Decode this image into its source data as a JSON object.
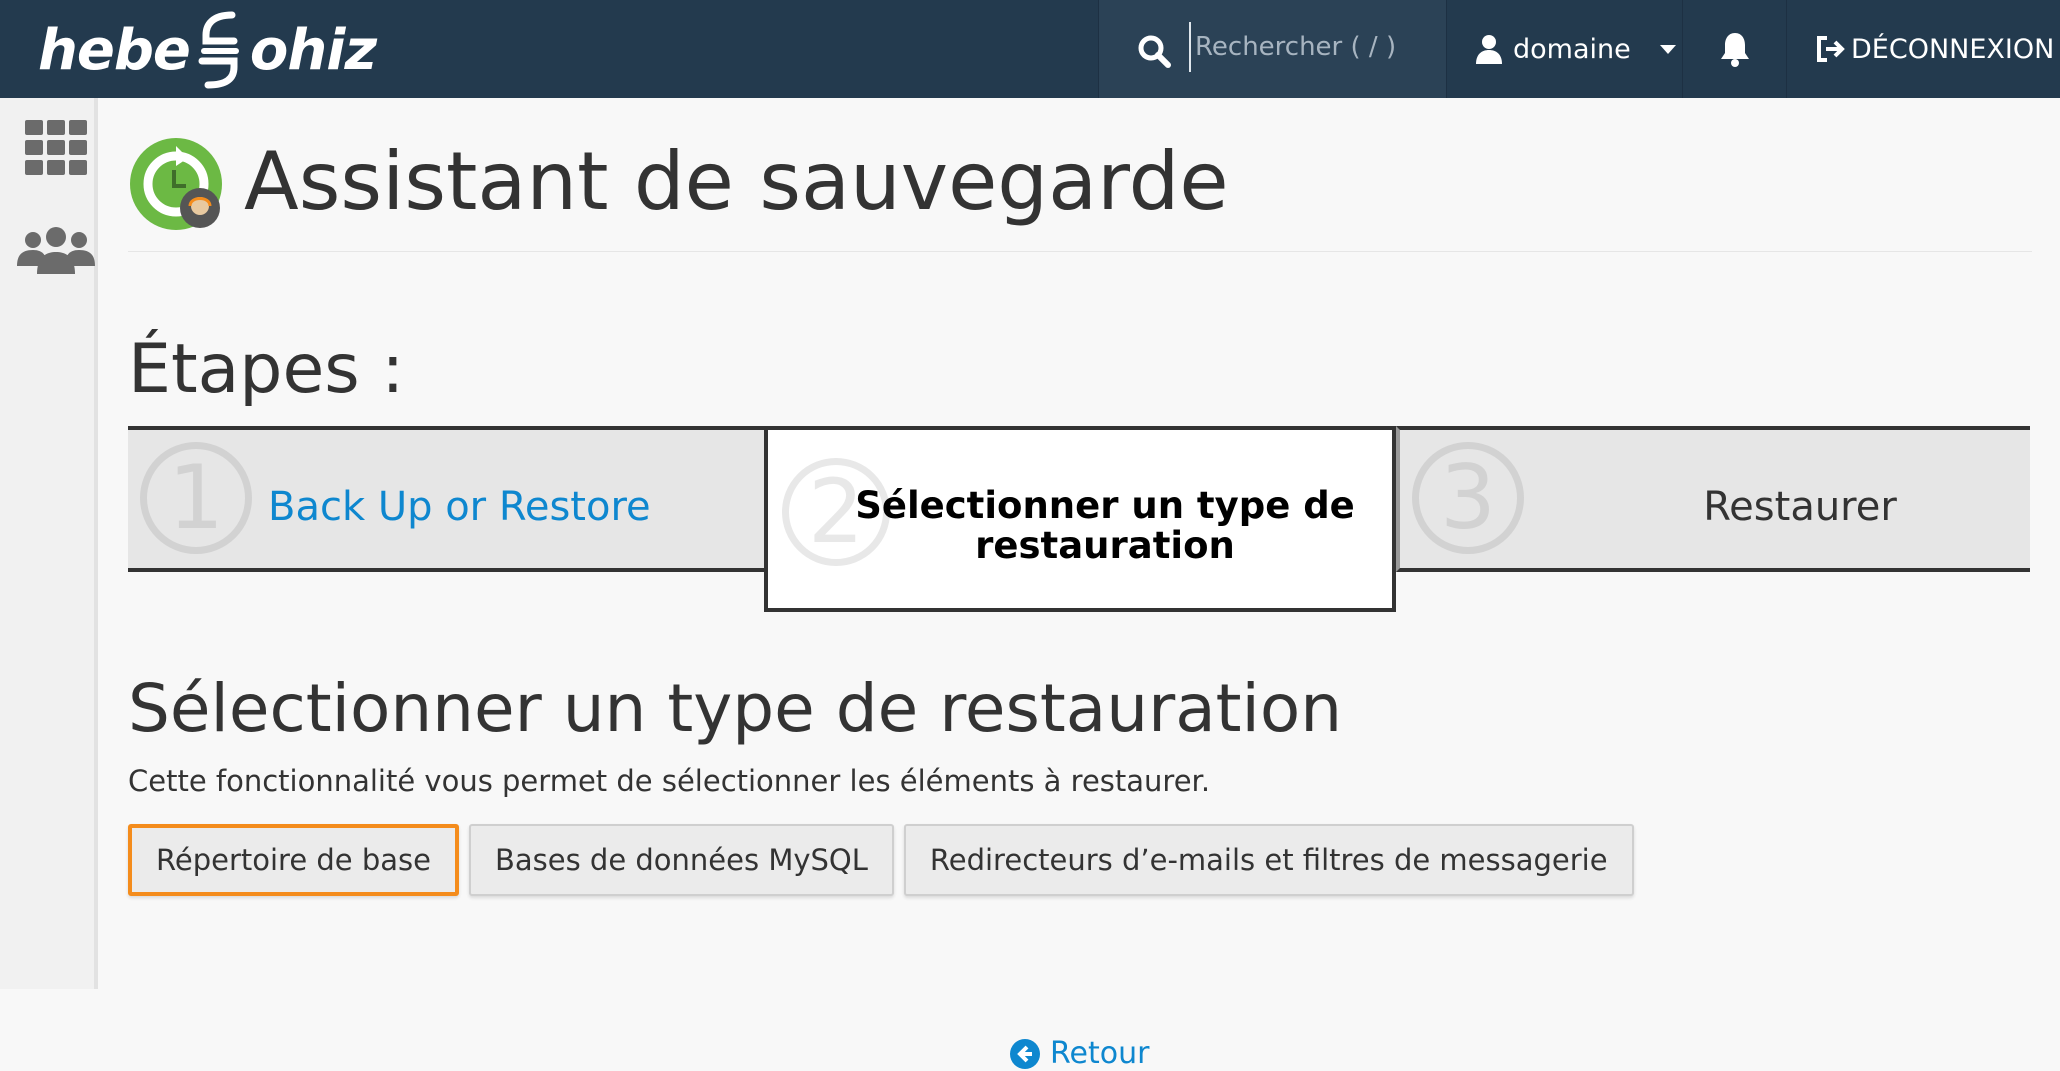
{
  "brand": {
    "logo_left": "hebe",
    "logo_right": "ohiz",
    "colors": {
      "topbar": "#233a4e",
      "link": "#0e87cf",
      "active_outline": "#f48c1c",
      "accent_green": "#6cb944"
    }
  },
  "topbar": {
    "search_placeholder": "Rechercher ( / )",
    "user_label": "domaine",
    "logout_label": "DÉCONNEXION",
    "icons": [
      "search-icon",
      "user-icon",
      "chevron-down-icon",
      "bell-icon",
      "logout-icon"
    ]
  },
  "sidebar": {
    "icons": [
      "grid-icon",
      "users-icon"
    ]
  },
  "page": {
    "title": "Assistant de sauvegarde",
    "steps_heading": "Étapes :",
    "steps": [
      {
        "number": "1",
        "label": "Back Up or Restore",
        "state": "link"
      },
      {
        "number": "2",
        "label": "Sélectionner un type de restauration",
        "state": "current"
      },
      {
        "number": "3",
        "label": "Restaurer",
        "state": "upcoming"
      }
    ],
    "section_title": "Sélectionner un type de restauration",
    "section_desc": "Cette fonctionnalité vous permet de sélectionner les éléments à restaurer.",
    "restore_buttons": [
      {
        "label": "Répertoire de base",
        "active": true
      },
      {
        "label": "Bases de données MySQL",
        "active": false
      },
      {
        "label": "Redirecteurs d’e-mails et filtres de messagerie",
        "active": false
      }
    ],
    "back_label": "Retour"
  }
}
